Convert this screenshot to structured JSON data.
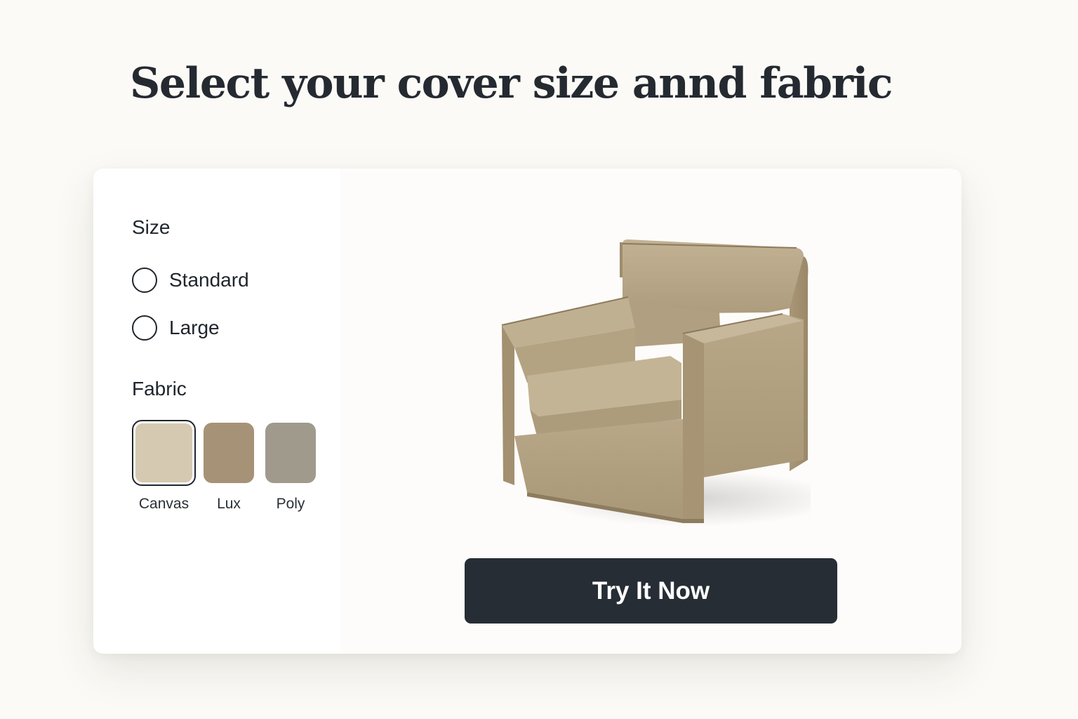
{
  "header": {
    "title": "Select your cover size annd fabric"
  },
  "options": {
    "size": {
      "label": "Size",
      "choices": [
        {
          "label": "Standard",
          "selected": false
        },
        {
          "label": "Large",
          "selected": false
        }
      ]
    },
    "fabric": {
      "label": "Fabric",
      "swatches": [
        {
          "name": "Canvas",
          "color": "#d6c9b1",
          "selected": true
        },
        {
          "name": "Lux",
          "color": "#a69377",
          "selected": false
        },
        {
          "name": "Poly",
          "color": "#a09a8d",
          "selected": false
        }
      ]
    }
  },
  "preview": {
    "product": "armchair",
    "cover_color": "#b8a788"
  },
  "cta": {
    "label": "Try It Now",
    "color": "#262d35"
  }
}
